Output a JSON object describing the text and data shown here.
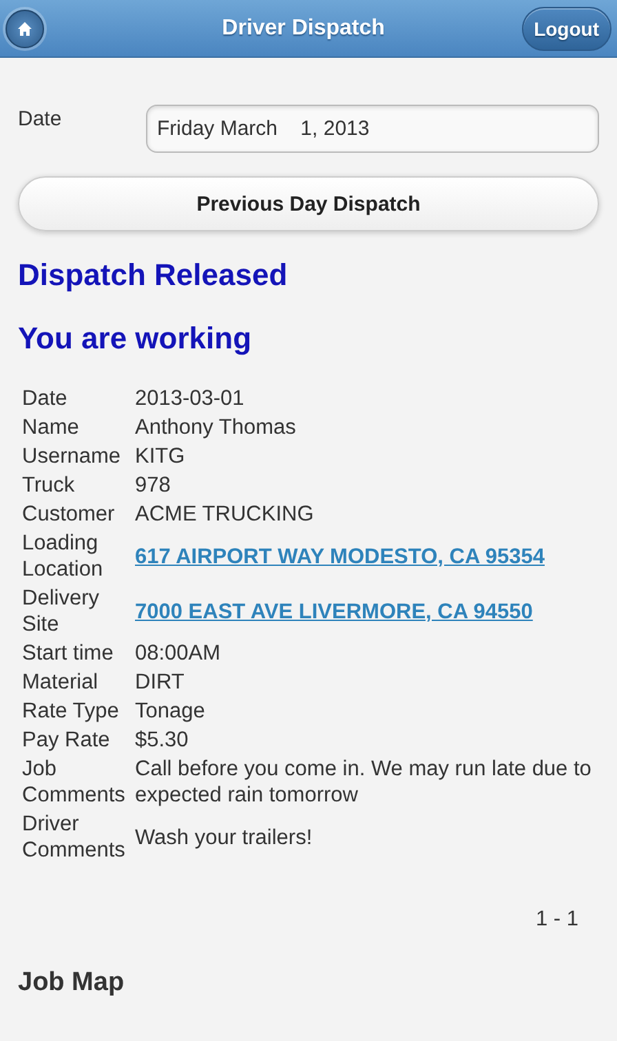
{
  "header": {
    "title": "Driver Dispatch",
    "logout": "Logout"
  },
  "date_field": {
    "label": "Date",
    "value": "Friday March    1, 2013"
  },
  "previous_button": "Previous Day Dispatch",
  "status_headings": [
    "Dispatch Released",
    "You are working"
  ],
  "details": [
    {
      "label": "Date",
      "value": "2013-03-01",
      "kind": "text"
    },
    {
      "label": "Name",
      "value": "Anthony Thomas",
      "kind": "text"
    },
    {
      "label": "Username",
      "value": "KITG",
      "kind": "text"
    },
    {
      "label": "Truck",
      "value": "978",
      "kind": "text"
    },
    {
      "label": "Customer",
      "value": "ACME TRUCKING",
      "kind": "text"
    },
    {
      "label": "Loading Location",
      "value": "617 AIRPORT WAY MODESTO, CA 95354",
      "kind": "link"
    },
    {
      "label": "Delivery Site",
      "value": "7000 EAST AVE LIVERMORE, CA 94550",
      "kind": "link"
    },
    {
      "label": "Start time",
      "value": "08:00AM",
      "kind": "text"
    },
    {
      "label": "Material",
      "value": "DIRT",
      "kind": "text"
    },
    {
      "label": "Rate Type",
      "value": "Tonage",
      "kind": "text"
    },
    {
      "label": "Pay Rate",
      "value": "$5.30",
      "kind": "text"
    },
    {
      "label": "Job Comments",
      "value": "Call before you come in. We may run late due to expected rain tomorrow",
      "kind": "text"
    },
    {
      "label": "Driver Comments",
      "value": "Wash your trailers!",
      "kind": "text"
    }
  ],
  "pagination": "1 - 1",
  "section_title": "Job Map"
}
